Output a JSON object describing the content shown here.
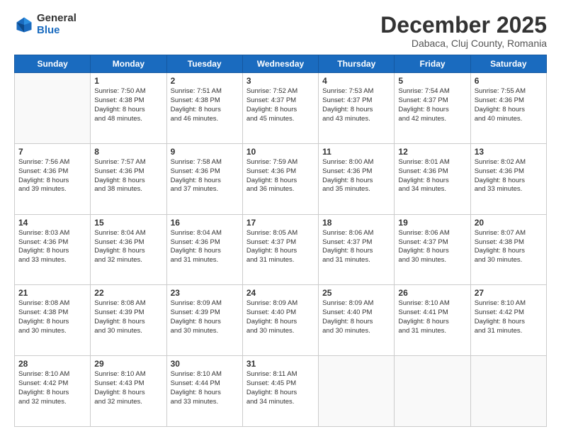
{
  "logo": {
    "general": "General",
    "blue": "Blue"
  },
  "header": {
    "month": "December 2025",
    "location": "Dabaca, Cluj County, Romania"
  },
  "days": [
    "Sunday",
    "Monday",
    "Tuesday",
    "Wednesday",
    "Thursday",
    "Friday",
    "Saturday"
  ],
  "weeks": [
    [
      {
        "day": "",
        "text": ""
      },
      {
        "day": "1",
        "text": "Sunrise: 7:50 AM\nSunset: 4:38 PM\nDaylight: 8 hours\nand 48 minutes."
      },
      {
        "day": "2",
        "text": "Sunrise: 7:51 AM\nSunset: 4:38 PM\nDaylight: 8 hours\nand 46 minutes."
      },
      {
        "day": "3",
        "text": "Sunrise: 7:52 AM\nSunset: 4:37 PM\nDaylight: 8 hours\nand 45 minutes."
      },
      {
        "day": "4",
        "text": "Sunrise: 7:53 AM\nSunset: 4:37 PM\nDaylight: 8 hours\nand 43 minutes."
      },
      {
        "day": "5",
        "text": "Sunrise: 7:54 AM\nSunset: 4:37 PM\nDaylight: 8 hours\nand 42 minutes."
      },
      {
        "day": "6",
        "text": "Sunrise: 7:55 AM\nSunset: 4:36 PM\nDaylight: 8 hours\nand 40 minutes."
      }
    ],
    [
      {
        "day": "7",
        "text": "Sunrise: 7:56 AM\nSunset: 4:36 PM\nDaylight: 8 hours\nand 39 minutes."
      },
      {
        "day": "8",
        "text": "Sunrise: 7:57 AM\nSunset: 4:36 PM\nDaylight: 8 hours\nand 38 minutes."
      },
      {
        "day": "9",
        "text": "Sunrise: 7:58 AM\nSunset: 4:36 PM\nDaylight: 8 hours\nand 37 minutes."
      },
      {
        "day": "10",
        "text": "Sunrise: 7:59 AM\nSunset: 4:36 PM\nDaylight: 8 hours\nand 36 minutes."
      },
      {
        "day": "11",
        "text": "Sunrise: 8:00 AM\nSunset: 4:36 PM\nDaylight: 8 hours\nand 35 minutes."
      },
      {
        "day": "12",
        "text": "Sunrise: 8:01 AM\nSunset: 4:36 PM\nDaylight: 8 hours\nand 34 minutes."
      },
      {
        "day": "13",
        "text": "Sunrise: 8:02 AM\nSunset: 4:36 PM\nDaylight: 8 hours\nand 33 minutes."
      }
    ],
    [
      {
        "day": "14",
        "text": "Sunrise: 8:03 AM\nSunset: 4:36 PM\nDaylight: 8 hours\nand 33 minutes."
      },
      {
        "day": "15",
        "text": "Sunrise: 8:04 AM\nSunset: 4:36 PM\nDaylight: 8 hours\nand 32 minutes."
      },
      {
        "day": "16",
        "text": "Sunrise: 8:04 AM\nSunset: 4:36 PM\nDaylight: 8 hours\nand 31 minutes."
      },
      {
        "day": "17",
        "text": "Sunrise: 8:05 AM\nSunset: 4:37 PM\nDaylight: 8 hours\nand 31 minutes."
      },
      {
        "day": "18",
        "text": "Sunrise: 8:06 AM\nSunset: 4:37 PM\nDaylight: 8 hours\nand 31 minutes."
      },
      {
        "day": "19",
        "text": "Sunrise: 8:06 AM\nSunset: 4:37 PM\nDaylight: 8 hours\nand 30 minutes."
      },
      {
        "day": "20",
        "text": "Sunrise: 8:07 AM\nSunset: 4:38 PM\nDaylight: 8 hours\nand 30 minutes."
      }
    ],
    [
      {
        "day": "21",
        "text": "Sunrise: 8:08 AM\nSunset: 4:38 PM\nDaylight: 8 hours\nand 30 minutes."
      },
      {
        "day": "22",
        "text": "Sunrise: 8:08 AM\nSunset: 4:39 PM\nDaylight: 8 hours\nand 30 minutes."
      },
      {
        "day": "23",
        "text": "Sunrise: 8:09 AM\nSunset: 4:39 PM\nDaylight: 8 hours\nand 30 minutes."
      },
      {
        "day": "24",
        "text": "Sunrise: 8:09 AM\nSunset: 4:40 PM\nDaylight: 8 hours\nand 30 minutes."
      },
      {
        "day": "25",
        "text": "Sunrise: 8:09 AM\nSunset: 4:40 PM\nDaylight: 8 hours\nand 30 minutes."
      },
      {
        "day": "26",
        "text": "Sunrise: 8:10 AM\nSunset: 4:41 PM\nDaylight: 8 hours\nand 31 minutes."
      },
      {
        "day": "27",
        "text": "Sunrise: 8:10 AM\nSunset: 4:42 PM\nDaylight: 8 hours\nand 31 minutes."
      }
    ],
    [
      {
        "day": "28",
        "text": "Sunrise: 8:10 AM\nSunset: 4:42 PM\nDaylight: 8 hours\nand 32 minutes."
      },
      {
        "day": "29",
        "text": "Sunrise: 8:10 AM\nSunset: 4:43 PM\nDaylight: 8 hours\nand 32 minutes."
      },
      {
        "day": "30",
        "text": "Sunrise: 8:10 AM\nSunset: 4:44 PM\nDaylight: 8 hours\nand 33 minutes."
      },
      {
        "day": "31",
        "text": "Sunrise: 8:11 AM\nSunset: 4:45 PM\nDaylight: 8 hours\nand 34 minutes."
      },
      {
        "day": "",
        "text": ""
      },
      {
        "day": "",
        "text": ""
      },
      {
        "day": "",
        "text": ""
      }
    ]
  ]
}
